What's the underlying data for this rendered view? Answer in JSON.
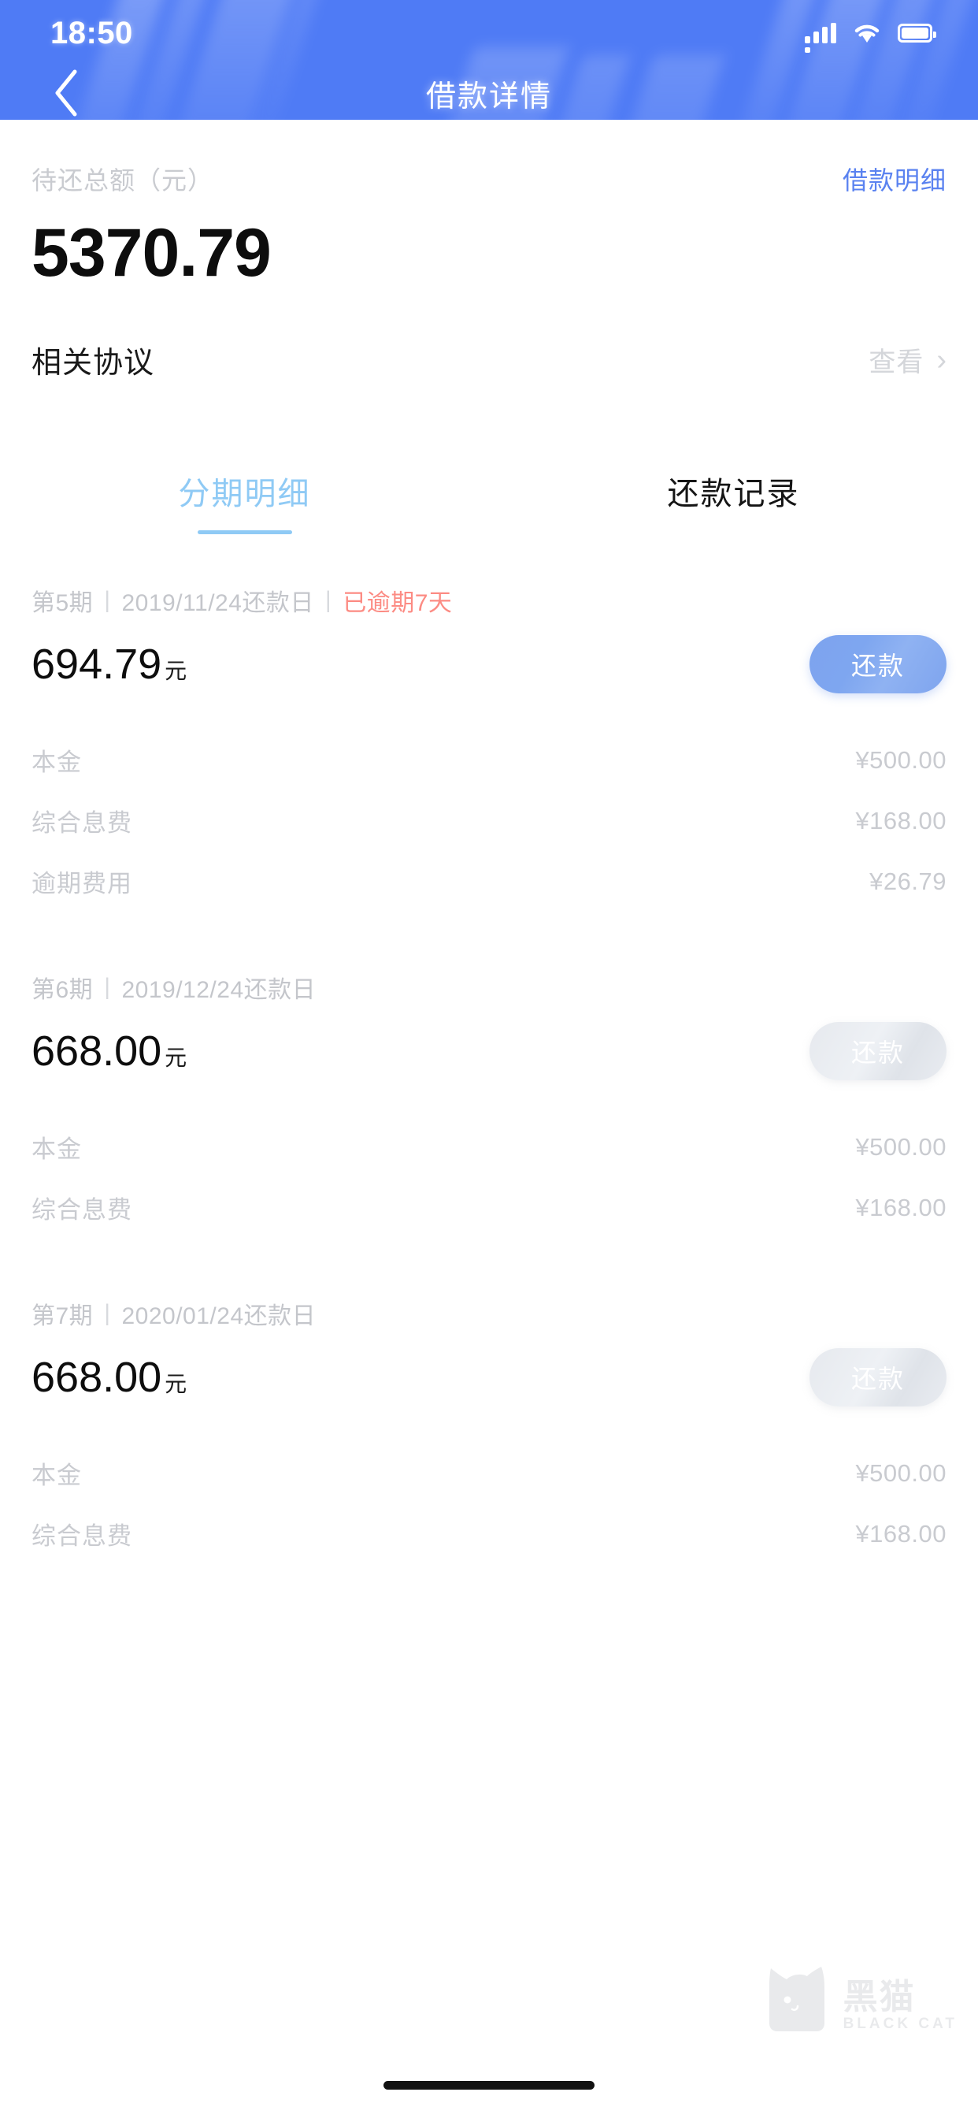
{
  "status_bar": {
    "time": "18:50",
    "icons": [
      "signal-icon",
      "wifi-icon",
      "battery-icon"
    ]
  },
  "nav": {
    "title": "借款详情",
    "back_icon": "chevron-left-icon"
  },
  "summary": {
    "label": "待还总额（元）",
    "amount": "5370.79",
    "detail_link": "借款明细"
  },
  "agreement": {
    "label": "相关协议",
    "action": "查看",
    "chevron": "›"
  },
  "tabs": [
    {
      "label": "分期明细",
      "active": true
    },
    {
      "label": "还款记录",
      "active": false
    }
  ],
  "installments": [
    {
      "period": "第5期",
      "sep": "|",
      "due": "2019/11/24还款日",
      "sep2": "|",
      "status": "已逾期7天",
      "amount": "694.79",
      "unit": "元",
      "button": "还款",
      "button_enabled": true,
      "details": [
        {
          "label": "本金",
          "value": "¥500.00"
        },
        {
          "label": "综合息费",
          "value": "¥168.00"
        },
        {
          "label": "逾期费用",
          "value": "¥26.79"
        }
      ]
    },
    {
      "period": "第6期",
      "sep": "|",
      "due": "2019/12/24还款日",
      "sep2": "",
      "status": "",
      "amount": "668.00",
      "unit": "元",
      "button": "还款",
      "button_enabled": false,
      "details": [
        {
          "label": "本金",
          "value": "¥500.00"
        },
        {
          "label": "综合息费",
          "value": "¥168.00"
        }
      ]
    },
    {
      "period": "第7期",
      "sep": "|",
      "due": "2020/01/24还款日",
      "sep2": "",
      "status": "",
      "amount": "668.00",
      "unit": "元",
      "button": "还款",
      "button_enabled": false,
      "details": [
        {
          "label": "本金",
          "value": "¥500.00"
        },
        {
          "label": "综合息费",
          "value": "¥168.00"
        }
      ]
    }
  ],
  "watermark": {
    "cn": "黑猫",
    "en": "BLACK CAT"
  },
  "colors": {
    "header_blue": "#4f7bf5",
    "link_blue": "#5a82f0",
    "tab_active": "#8fcaf5",
    "overdue_red": "#fc8b83",
    "muted_gray": "#c9cbd0"
  }
}
